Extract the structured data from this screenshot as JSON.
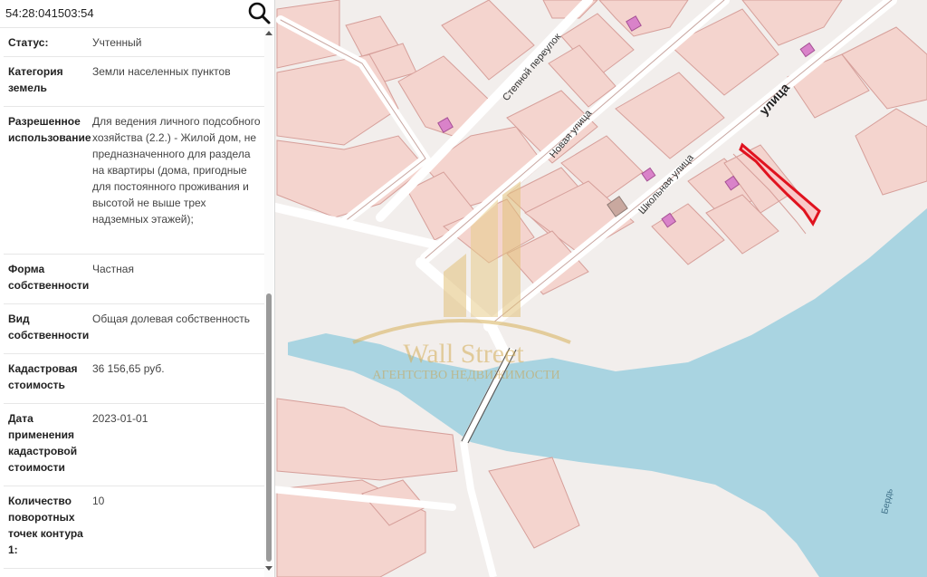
{
  "search": {
    "value": "54:28:041503:54",
    "icon": "search-icon"
  },
  "parcel": {
    "rows": [
      {
        "label": "Статус:",
        "value": "Учтенный"
      },
      {
        "label": "Категория земель",
        "value": "Земли населенных пунктов"
      },
      {
        "label": "Разрешенное использование",
        "value": "Для ведения личного подсобного хозяйства (2.2.) - Жилой дом, не предназначенного для раздела на квартиры (дома, пригодные для постоянного проживания и высотой не выше трех надземных этажей);"
      },
      {
        "label": "Форма собственности",
        "value": "Частная"
      },
      {
        "label": "Вид собственности",
        "value": "Общая долевая собственность"
      },
      {
        "label": "Кадастровая стоимость",
        "value": "36 156,65 руб."
      },
      {
        "label": "Дата применения кадастровой стоимости",
        "value": "2023-01-01"
      },
      {
        "label": "Количество поворотных точек контура 1:",
        "value": "10"
      }
    ]
  },
  "map": {
    "streets": {
      "stepnoy": "Степной переулок",
      "novaya": "Новая улица",
      "shkolnaya": "Школьная улица",
      "ulitsa_top": "улица",
      "river": "Бердь"
    },
    "watermark": {
      "title": "Wall Street",
      "subtitle": "АГЕНТСТВО НЕДВИЖИМОСТИ"
    },
    "colors": {
      "land": "#f2eeec",
      "parcel": "#f4d4ce",
      "water": "#a9d4e1",
      "building": "#d982c9",
      "highlight": "#e0131f"
    }
  }
}
